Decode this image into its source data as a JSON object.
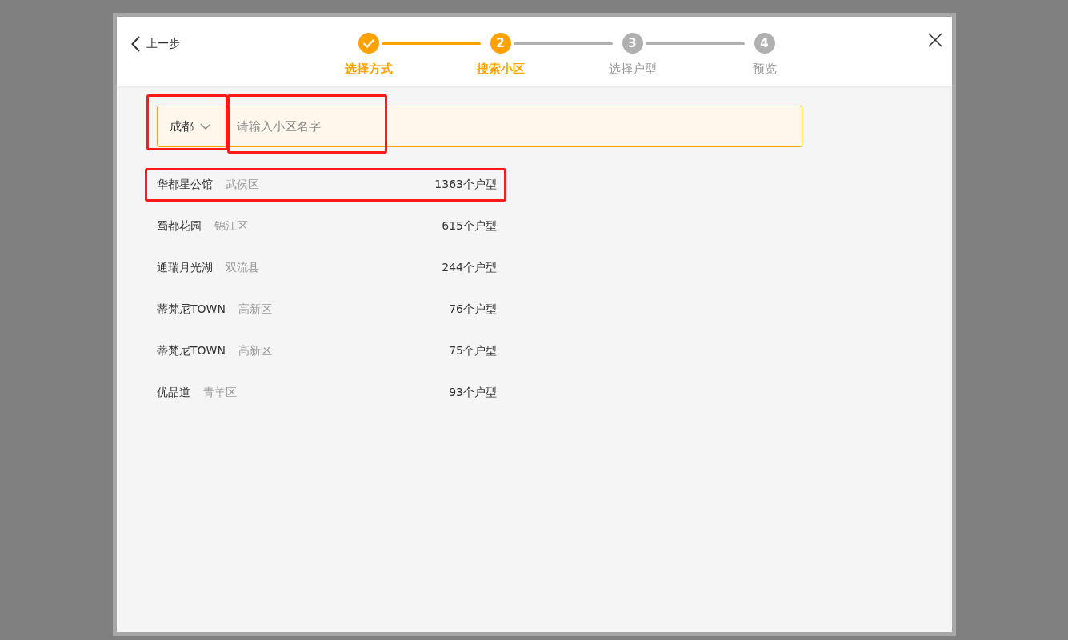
{
  "header": {
    "back_label": "上一步"
  },
  "steps": [
    {
      "label": "选择方式",
      "completed": true,
      "reached": true
    },
    {
      "number": "2",
      "label": "搜索小区",
      "completed": false,
      "reached": true
    },
    {
      "number": "3",
      "label": "选择户型",
      "completed": false,
      "reached": false
    },
    {
      "number": "4",
      "label": "预览",
      "completed": false,
      "reached": false
    }
  ],
  "search": {
    "city": "成都",
    "city_highlighted": true,
    "placeholder": "请输入小区名字",
    "input_highlighted": true
  },
  "results": [
    {
      "name": "华都星公馆",
      "district": "武侯区",
      "count": "1363个户型",
      "highlighted": true
    },
    {
      "name": "蜀都花园",
      "district": "锦江区",
      "count": "615个户型",
      "highlighted": false
    },
    {
      "name": "通瑞月光湖",
      "district": "双流县",
      "count": "244个户型",
      "highlighted": false
    },
    {
      "name": "蒂梵尼TOWN",
      "district": "高新区",
      "count": "76个户型",
      "highlighted": false
    },
    {
      "name": "蒂梵尼TOWN",
      "district": "高新区",
      "count": "75个户型",
      "highlighted": false
    },
    {
      "name": "优品道",
      "district": "青羊区",
      "count": "93个户型",
      "highlighted": false
    }
  ]
}
